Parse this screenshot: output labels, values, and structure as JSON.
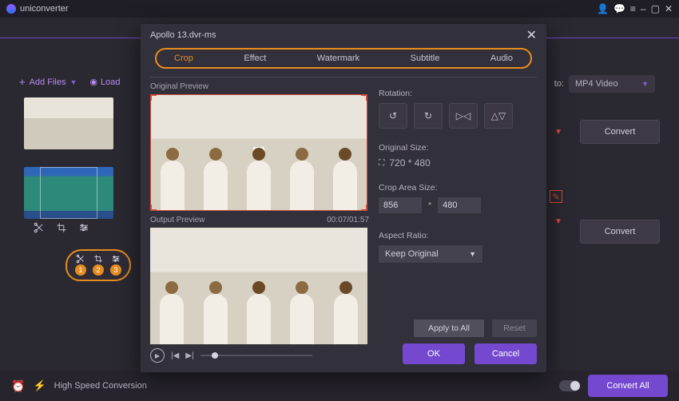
{
  "app": {
    "name": "uniconverter"
  },
  "window_icons": {
    "user": "user-icon",
    "chat": "chat-icon",
    "menu": "menu-icon",
    "min": "–",
    "max": "▢",
    "close": "✕"
  },
  "toolbar": {
    "add_files": "Add Files",
    "load": "Load"
  },
  "output": {
    "to_label": "to:",
    "format": "MP4 Video"
  },
  "convert": {
    "label": "Convert"
  },
  "edit_tools": {
    "nums": [
      "1",
      "2",
      "3"
    ]
  },
  "bottom": {
    "high_speed": "High Speed Conversion",
    "convert_all": "Convert All"
  },
  "modal": {
    "title": "Apollo 13.dvr-ms",
    "tabs": [
      "Crop",
      "Effect",
      "Watermark",
      "Subtitle",
      "Audio"
    ],
    "active_tab": "Crop",
    "original_preview": "Original Preview",
    "output_preview": "Output Preview",
    "timecode": "00:07/01:57",
    "rotation_label": "Rotation:",
    "original_size_label": "Original Size:",
    "original_size": "720 * 480",
    "crop_area_label": "Crop Area Size:",
    "crop_w": "856",
    "crop_h": "480",
    "times": "*",
    "aspect_label": "Aspect Ratio:",
    "aspect_value": "Keep Original",
    "apply_all": "Apply to All",
    "reset": "Reset",
    "ok": "OK",
    "cancel": "Cancel"
  }
}
